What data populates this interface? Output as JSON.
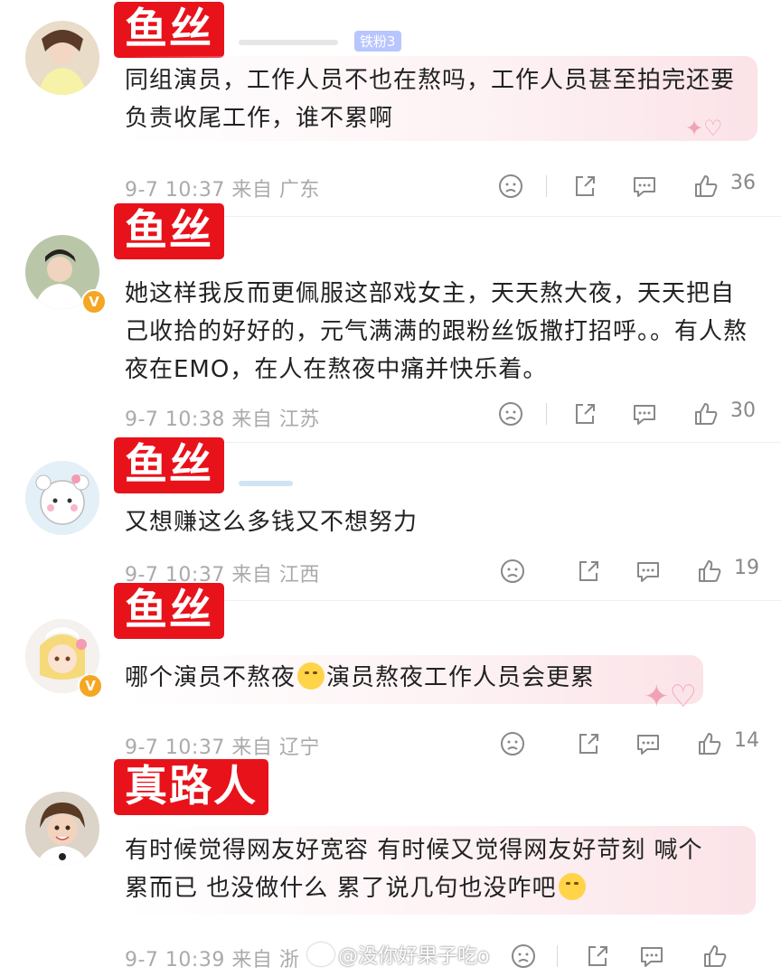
{
  "comments": [
    {
      "tag": "鱼丝",
      "fan_badge": "铁粉3",
      "text": "同组演员，工作人员不也在熬吗，工作人员甚至拍完还要负责收尾工作，谁不累啊",
      "time": "9-7 10:37",
      "location": "来自 广东",
      "likes": "36"
    },
    {
      "tag": "鱼丝",
      "text": "她这样我反而更佩服这部戏女主，天天熬大夜，天天把自己收拾的好好的，元气满满的跟粉丝饭撒打招呼。。有人熬夜在EMO，在人在熬夜中痛并快乐着。",
      "time": "9-7 10:38",
      "location": "来自 江苏",
      "likes": "30"
    },
    {
      "tag": "鱼丝",
      "text": "又想赚这么多钱又不想努力",
      "time": "9-7 10:37",
      "location": "来自 江西",
      "likes": "19"
    },
    {
      "tag": "鱼丝",
      "text_before": "哪个演员不熬夜",
      "text_after": "演员熬夜工作人员会更累",
      "emoji": "smirk-emoji",
      "time": "9-7 10:37",
      "location": "来自 辽宁",
      "likes": "14"
    },
    {
      "tag": "真路人",
      "text_line1": "有时候觉得网友好宽容 有时候又觉得网友好苛刻 喊个",
      "text_line2": "累而已 也没做什么 累了说几句也没咋吧",
      "emoji": "relieved-emoji",
      "time": "9-7 10:39",
      "location": "来自 浙"
    }
  ],
  "verified_badge": "V",
  "watermark": "@没你好果子吃o",
  "icons": [
    "dislike-icon",
    "share-icon",
    "reply-icon",
    "like-icon"
  ],
  "colors": {
    "tag_red": "#e8121b",
    "meta_gray": "#aaaaaa",
    "verified_orange": "#f5a623"
  }
}
